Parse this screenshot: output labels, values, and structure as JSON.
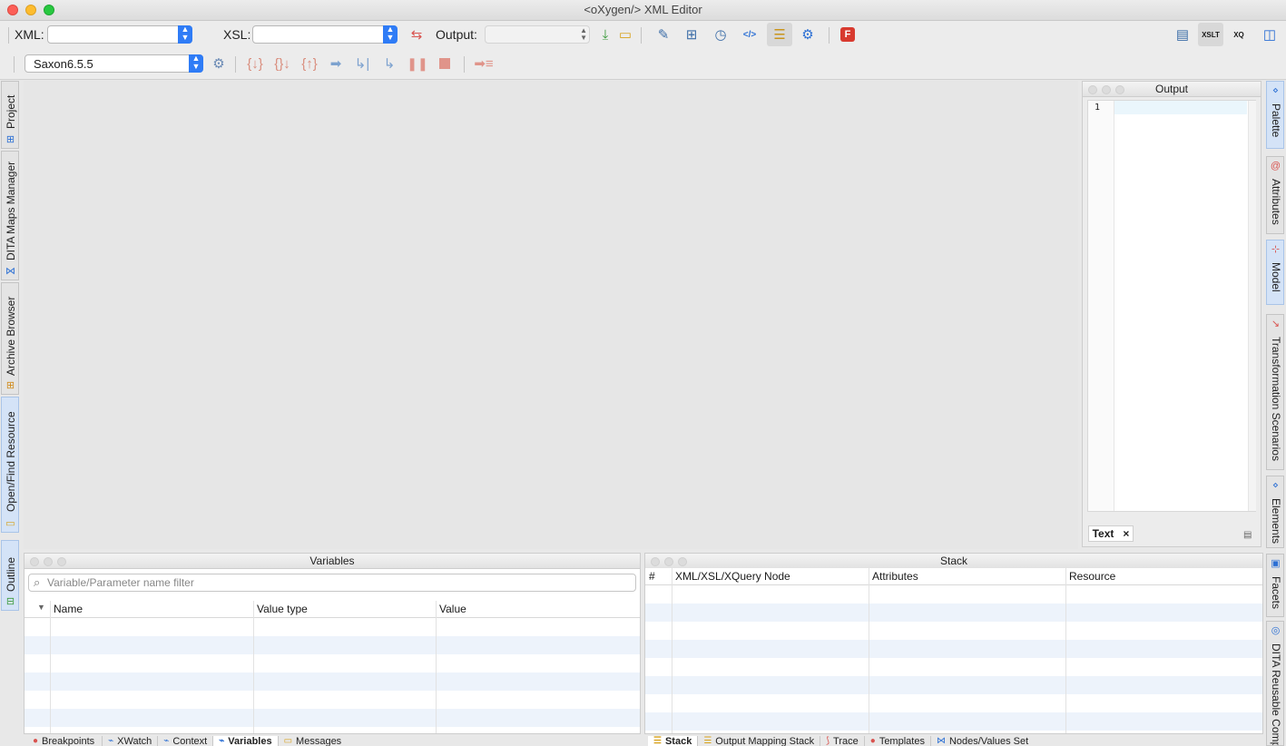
{
  "window": {
    "title": "<oXygen/> XML Editor"
  },
  "toolbar1": {
    "xml_label": "XML:",
    "xml_value": "",
    "xsl_label": "XSL:",
    "xsl_value": "",
    "output_label": "Output:",
    "output_value": "",
    "icons": [
      "swap-icon",
      "download-icon",
      "open-folder-icon",
      "xpath-settings-icon",
      "configure-icon",
      "timer-play-icon",
      "html-output-icon",
      "database-icon",
      "gear-icon",
      "f-app-icon"
    ],
    "right_icons": [
      "layout-icon",
      "xslt-icon",
      "xquery-icon",
      "window-icon"
    ],
    "right_icon_labels": {
      "xslt": "XSLT",
      "xquery": "XQ"
    }
  },
  "toolbar2": {
    "engine_value": "Saxon6.5.5",
    "icons": [
      "engine-settings-icon",
      "step-into-icon",
      "step-over-icon",
      "step-out-icon",
      "run-icon",
      "run-to-end-icon",
      "run-to-cursor-icon",
      "pause-icon",
      "stop-icon",
      "show-output-icon"
    ]
  },
  "left_tabs": [
    {
      "label": "Project",
      "icon": "project-icon"
    },
    {
      "label": "DITA Maps Manager",
      "icon": "dita-maps-icon"
    },
    {
      "label": "Archive Browser",
      "icon": "archive-icon"
    },
    {
      "label": "Open/Find Resource",
      "icon": "open-find-icon"
    },
    {
      "label": "Outline",
      "icon": "outline-icon"
    }
  ],
  "right_tabs": [
    {
      "label": "Palette",
      "icon": "palette-icon"
    },
    {
      "label": "Attributes",
      "icon": "attributes-icon"
    },
    {
      "label": "Model",
      "icon": "model-icon"
    },
    {
      "label": "Transformation Scenarios",
      "icon": "scenarios-icon"
    },
    {
      "label": "Elements",
      "icon": "elements-icon"
    },
    {
      "label": "Facets",
      "icon": "facets-icon"
    },
    {
      "label": "DITA Reusable Comp",
      "icon": "dita-reusable-icon"
    }
  ],
  "output_panel": {
    "title": "Output",
    "line_number": "1",
    "tab_label": "Text",
    "tab_close": "×"
  },
  "variables_panel": {
    "title": "Variables",
    "filter_placeholder": "Variable/Parameter name filter",
    "columns": [
      "Name",
      "Value type",
      "Value"
    ]
  },
  "stack_panel": {
    "title": "Stack",
    "columns": [
      "#",
      "XML/XSL/XQuery Node",
      "Attributes",
      "Resource"
    ]
  },
  "bottom_tabs_left": [
    {
      "label": "Breakpoints",
      "icon": "breakpoint-icon"
    },
    {
      "label": "XWatch",
      "icon": "xwatch-icon"
    },
    {
      "label": "Context",
      "icon": "context-icon"
    },
    {
      "label": "Variables",
      "icon": "variables-icon"
    },
    {
      "label": "Messages",
      "icon": "messages-icon"
    }
  ],
  "bottom_tabs_right": [
    {
      "label": "Stack",
      "icon": "stack-icon"
    },
    {
      "label": "Output Mapping Stack",
      "icon": "mapping-stack-icon"
    },
    {
      "label": "Trace",
      "icon": "trace-icon"
    },
    {
      "label": "Templates",
      "icon": "templates-icon"
    },
    {
      "label": "Nodes/Values Set",
      "icon": "nodes-icon"
    }
  ],
  "colors": {
    "accent": "#2f7cf6",
    "row_alt": "#edf3fb",
    "debug_red": "#d9534f"
  }
}
